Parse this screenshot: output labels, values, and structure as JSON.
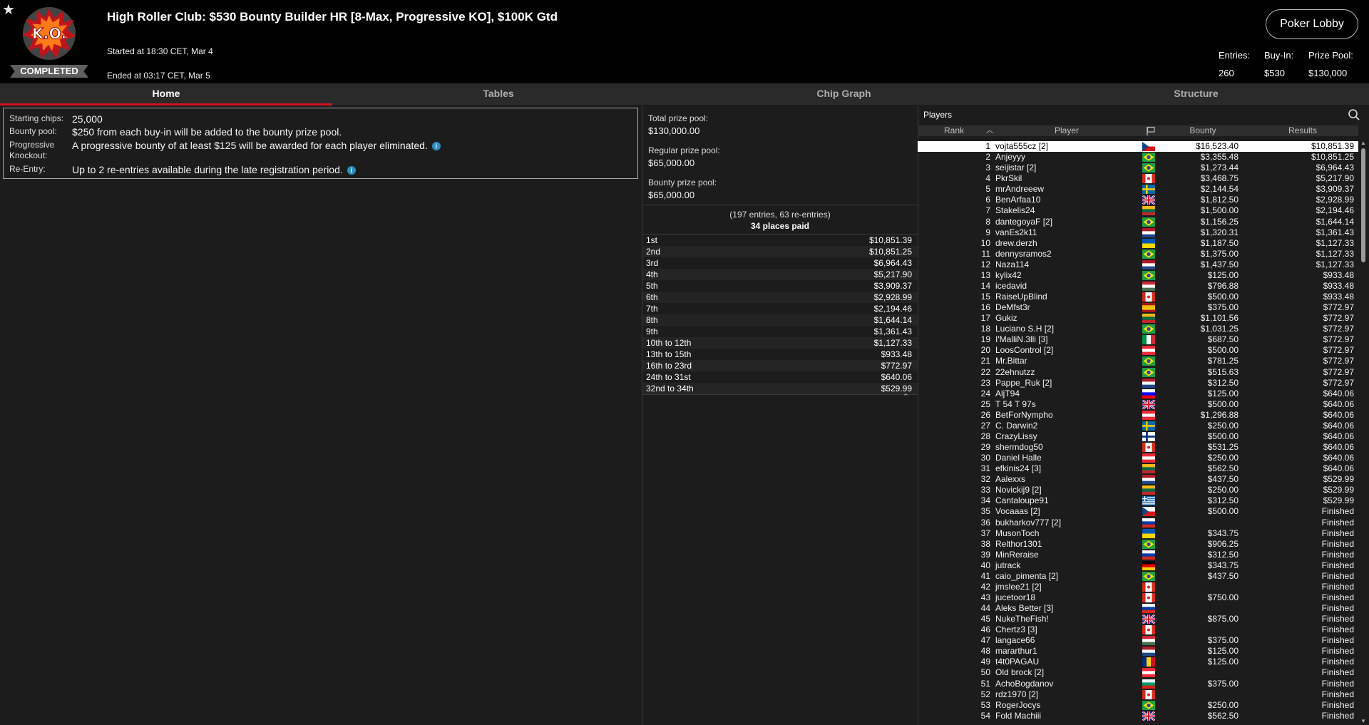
{
  "header": {
    "title": "High Roller Club: $530 Bounty Builder HR [8-Max, Progressive KO], $100K Gtd",
    "started": "Started at 18:30 CET, Mar 4",
    "ended": "Ended at 03:17 CET, Mar 5",
    "status": "COMPLETED",
    "logo_text": "K.O.",
    "lobby_button": "Poker Lobby",
    "entries_label": "Entries:",
    "entries": "260",
    "buyin_label": "Buy-In:",
    "buyin": "$530",
    "prizepool_label": "Prize Pool:",
    "prizepool": "$130,000"
  },
  "tabs": [
    "Home",
    "Tables",
    "Chip Graph",
    "Structure"
  ],
  "info": {
    "starting_label": "Starting chips:",
    "starting": "25,000",
    "bounty_label": "Bounty pool:",
    "bounty": "$250 from each buy-in will be added to the bounty prize pool.",
    "pko_label": "Progressive Knockout:",
    "pko": "A progressive bounty of at least $125 will be awarded for each player eliminated.",
    "reentry_label": "Re-Entry:",
    "reentry": "Up to 2 re-entries available during the late registration period.",
    "info_glyph": "i"
  },
  "prize": {
    "total_label": "Total prize pool:",
    "total": "$130,000.00",
    "regular_label": "Regular prize pool:",
    "regular": "$65,000.00",
    "bounty_label": "Bounty prize pool:",
    "bounty": "$65,000.00",
    "entries_note": "(197 entries, 63 re-entries)",
    "places_paid": "34 places paid",
    "payouts": [
      [
        "1st",
        "$10,851.39"
      ],
      [
        "2nd",
        "$10,851.25"
      ],
      [
        "3rd",
        "$6,964.43"
      ],
      [
        "4th",
        "$5,217.90"
      ],
      [
        "5th",
        "$3,909.37"
      ],
      [
        "6th",
        "$2,928.99"
      ],
      [
        "7th",
        "$2,194.46"
      ],
      [
        "8th",
        "$1,644.14"
      ],
      [
        "9th",
        "$1,361.43"
      ],
      [
        "10th to 12th",
        "$1,127.33"
      ],
      [
        "13th to 15th",
        "$933.48"
      ],
      [
        "16th to 23rd",
        "$772.97"
      ],
      [
        "24th to 31st",
        "$640.06"
      ],
      [
        "32nd to 34th",
        "$529.99"
      ]
    ]
  },
  "players": {
    "title": "Players",
    "columns": {
      "rank": "Rank",
      "player": "Player",
      "bounty": "Bounty",
      "results": "Results"
    },
    "rows": [
      [
        1,
        "vojta555cz [2]",
        "cz",
        "$16,523.40",
        "$10,851.39"
      ],
      [
        2,
        "Anjeyyy",
        "br",
        "$3,355.48",
        "$10,851.25"
      ],
      [
        3,
        "seijistar [2]",
        "br",
        "$1,273.44",
        "$6,964.43"
      ],
      [
        4,
        "PkrSkil",
        "ca",
        "$3,468.75",
        "$5,217.90"
      ],
      [
        5,
        "mrAndreeew",
        "se",
        "$2,144.54",
        "$3,909.37"
      ],
      [
        6,
        "BenArfaa10",
        "gb",
        "$1,812.50",
        "$2,928.99"
      ],
      [
        7,
        "Stakelis24",
        "lt",
        "$1,500.00",
        "$2,194.46"
      ],
      [
        8,
        "dantegoyaF [2]",
        "br",
        "$1,156.25",
        "$1,644.14"
      ],
      [
        9,
        "vanEs2k11",
        "nl",
        "$1,320.31",
        "$1,361.43"
      ],
      [
        10,
        "drew.derzh",
        "ua",
        "$1,187.50",
        "$1,127.33"
      ],
      [
        11,
        "dennysramos2",
        "br",
        "$1,375.00",
        "$1,127.33"
      ],
      [
        12,
        "Naza114",
        "nl",
        "$1,437.50",
        "$1,127.33"
      ],
      [
        13,
        "kylix42",
        "br",
        "$125.00",
        "$933.48"
      ],
      [
        14,
        "icedavid",
        "hu",
        "$796.88",
        "$933.48"
      ],
      [
        15,
        "RaiseUpBlind",
        "ca",
        "$500.00",
        "$933.48"
      ],
      [
        16,
        "DeMfst3r",
        "es",
        "$375.00",
        "$772.97"
      ],
      [
        17,
        "Gukiz",
        "lt",
        "$1,101.56",
        "$772.97"
      ],
      [
        18,
        "Luciano S.H [2]",
        "br",
        "$1,031.25",
        "$772.97"
      ],
      [
        19,
        "I'MalliN.3lli [3]",
        "it",
        "$687.50",
        "$772.97"
      ],
      [
        20,
        "LoosControl [2]",
        "at",
        "$500.00",
        "$772.97"
      ],
      [
        21,
        "Mr.Bittar",
        "br",
        "$781.25",
        "$772.97"
      ],
      [
        22,
        "22ehnutzz",
        "br",
        "$515.63",
        "$772.97"
      ],
      [
        23,
        "Pappe_Ruk [2]",
        "nl",
        "$312.50",
        "$772.97"
      ],
      [
        24,
        "AljT94",
        "si",
        "$125.00",
        "$640.06"
      ],
      [
        25,
        "T 54 T 97s",
        "gb",
        "$500.00",
        "$640.06"
      ],
      [
        26,
        "BetForNympho",
        "at",
        "$1,296.88",
        "$640.06"
      ],
      [
        27,
        "C. Darwin2",
        "se",
        "$250.00",
        "$640.06"
      ],
      [
        28,
        "CrazyLissy",
        "fi",
        "$500.00",
        "$640.06"
      ],
      [
        29,
        "shermdog50",
        "ca",
        "$531.25",
        "$640.06"
      ],
      [
        30,
        "Daniel Halle",
        "at",
        "$250.00",
        "$640.06"
      ],
      [
        31,
        "efkinis24 [3]",
        "lt",
        "$562.50",
        "$640.06"
      ],
      [
        32,
        "Aalexxs",
        "nl",
        "$437.50",
        "$529.99"
      ],
      [
        33,
        "Novickij9 [2]",
        "lt",
        "$250.00",
        "$529.99"
      ],
      [
        34,
        "Cantaloupe91",
        "gr",
        "$312.50",
        "$529.99"
      ],
      [
        35,
        "Vocaaas [2]",
        "cz",
        "$500.00",
        "Finished"
      ],
      [
        36,
        "bukharkov777 [2]",
        "ru",
        "",
        "Finished"
      ],
      [
        37,
        "MusonToch",
        "ua",
        "$343.75",
        "Finished"
      ],
      [
        38,
        "Relthor1301",
        "br",
        "$906.25",
        "Finished"
      ],
      [
        39,
        "MinReraise",
        "ru",
        "$312.50",
        "Finished"
      ],
      [
        40,
        "jutrack",
        "de",
        "$343.75",
        "Finished"
      ],
      [
        41,
        "caio_pimenta [2]",
        "br",
        "$437.50",
        "Finished"
      ],
      [
        42,
        "jmslee21 [2]",
        "ca",
        "",
        "Finished"
      ],
      [
        43,
        "jucetoor18",
        "ca",
        "$750.00",
        "Finished"
      ],
      [
        44,
        "Aleks Better [3]",
        "ru",
        "",
        "Finished"
      ],
      [
        45,
        "NukeTheFish!",
        "gb",
        "$875.00",
        "Finished"
      ],
      [
        46,
        "Chertz3 [3]",
        "ca",
        "",
        "Finished"
      ],
      [
        47,
        "langace66",
        "hu",
        "$375.00",
        "Finished"
      ],
      [
        48,
        "mararthur1",
        "nl",
        "$125.00",
        "Finished"
      ],
      [
        49,
        "t4t0PAGAU",
        "ro",
        "$125.00",
        "Finished"
      ],
      [
        50,
        "Old brock [2]",
        "at",
        "",
        "Finished"
      ],
      [
        51,
        "AchoBogdanov",
        "bg",
        "$375.00",
        "Finished"
      ],
      [
        52,
        "rdz1970 [2]",
        "ca",
        "",
        "Finished"
      ],
      [
        53,
        "RogerJocys",
        "br",
        "$250.00",
        "Finished"
      ],
      [
        54,
        "Fold Machiii",
        "gb",
        "$562.50",
        "Finished"
      ]
    ]
  },
  "colors": {
    "accent": "#d3111e",
    "background": "#1c1c1c",
    "header": "#000000",
    "info_icon": "#2a8fc3"
  },
  "icons": [
    "star-icon",
    "ko-logo-icon",
    "search-icon",
    "sort-up-icon",
    "flag-icon",
    "collapse-icon",
    "info-icon"
  ]
}
